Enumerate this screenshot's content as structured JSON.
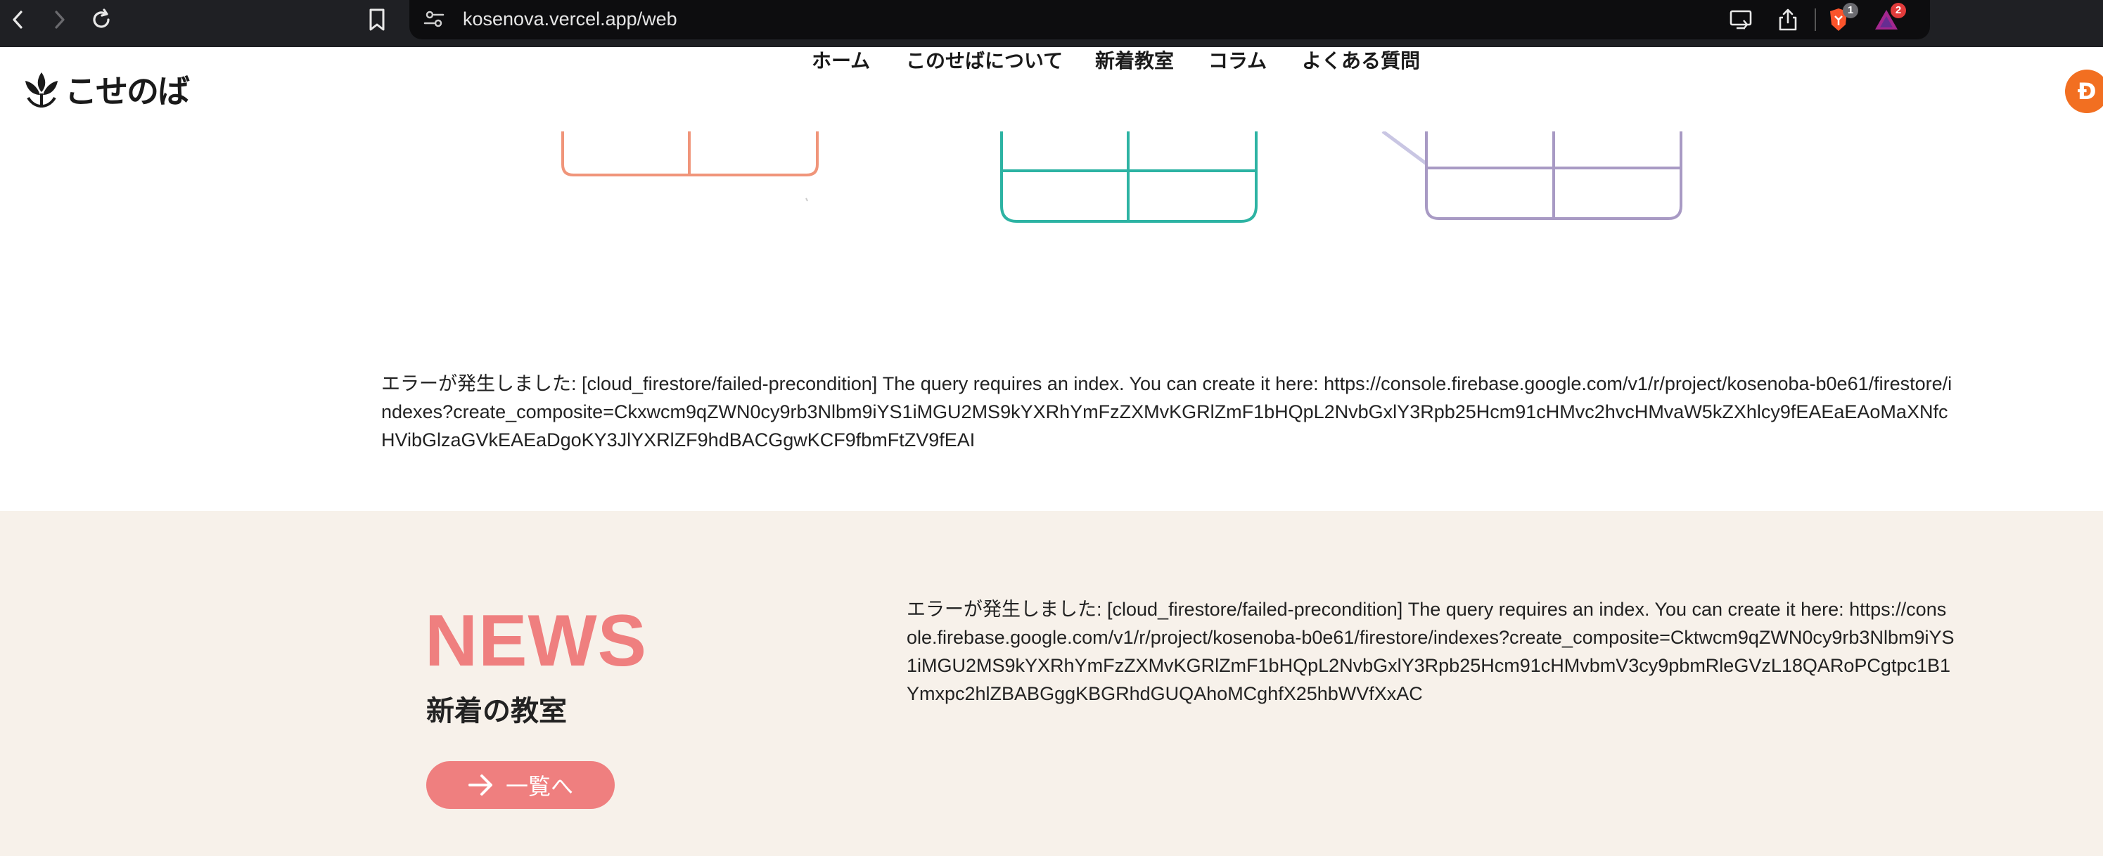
{
  "browser": {
    "url": "kosenova.vercel.app/web",
    "extensions": [
      {
        "name": "brave-shield-icon",
        "badge": "1"
      },
      {
        "name": "brave-rewards-icon",
        "badge": "2"
      }
    ]
  },
  "header": {
    "logo_text": "こせのば",
    "nav": [
      "ホーム",
      "このせばについて",
      "新着教室",
      "コラム",
      "よくある質問"
    ],
    "avatar_letter": "Ð"
  },
  "illustration": {
    "colors": {
      "salmon": "#f0957a",
      "teal": "#2db3a3",
      "lavender": "#a89ac4"
    }
  },
  "error_top": "エラーが発生しました: [cloud_firestore/failed-precondition] The query requires an index. You can create it here: https://console.firebase.google.com/v1/r/project/kosenoba-b0e61/firestore/indexes?create_composite=Ckxwcm9qZWN0cy9rb3Nlbm9iYS1iMGU2MS9kYXRhYmFzZXMvKGRlZmF1bHQpL2NvbGxlY3Rpb25Hcm91cHMvc2hvcHMvaW5kZXhlcy9fEAEaEAoMaXNfcHVibGlzaGVkEAEaDgoKY3JlYXRlZF9hdBACGgwKCF9fbmFtZV9fEAI",
  "news": {
    "title": "NEWS",
    "subtitle": "新着の教室",
    "button_label": "一覧へ",
    "error": "エラーが発生しました: [cloud_firestore/failed-precondition] The query requires an index. You can create it here: https://console.firebase.google.com/v1/r/project/kosenoba-b0e61/firestore/indexes?create_composite=Cktwcm9qZWN0cy9rb3Nlbm9iYS1iMGU2MS9kYXRhYmFzZXMvKGRlZmF1bHQpL2NvbGxlY3Rpb25Hcm91cHMvbmV3cy9pbmRleGVzL18QARoPCgtpc1B1Ymxpc2hlZBABGggKBGRhdGUQAhoMCghfX25hbWVfXxAC"
  },
  "colors": {
    "accent": "#ef7f7f",
    "section_bg": "#f7f1ea",
    "avatar": "#f26f21"
  }
}
